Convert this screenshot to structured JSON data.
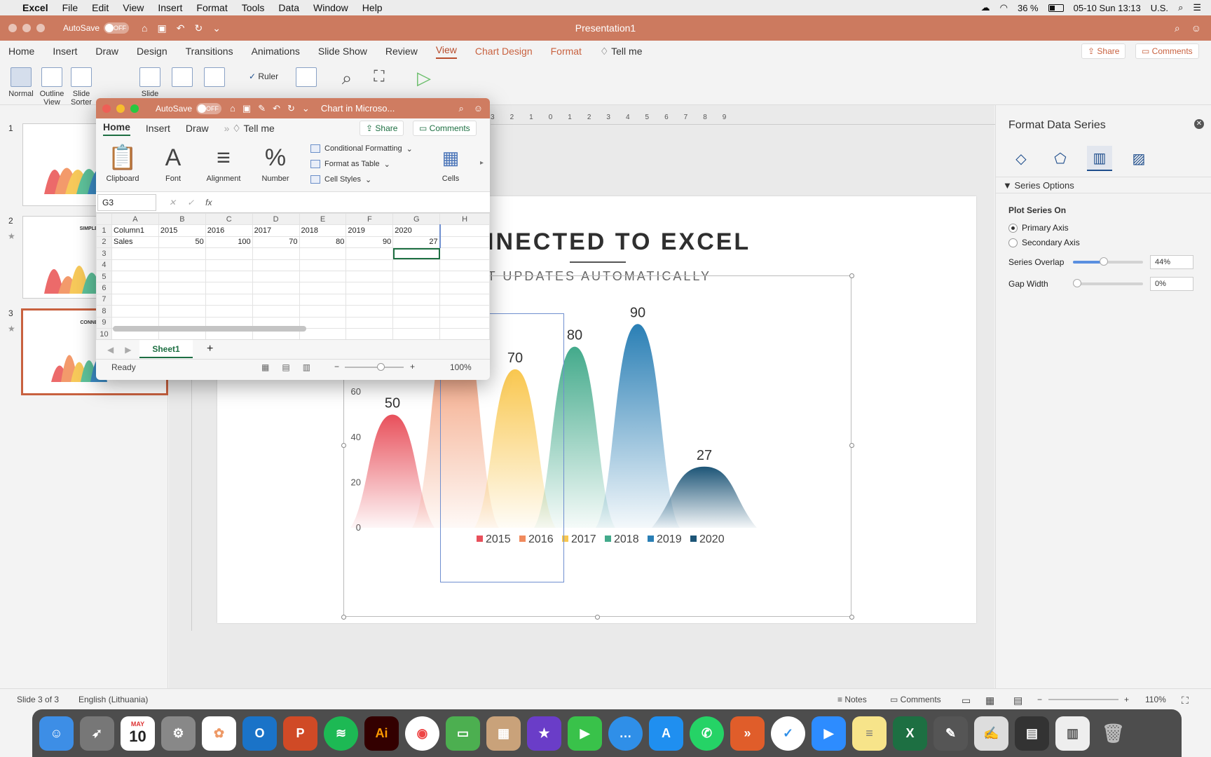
{
  "menubar": {
    "app": "Excel",
    "items": [
      "File",
      "Edit",
      "View",
      "Insert",
      "Format",
      "Tools",
      "Data",
      "Window",
      "Help"
    ],
    "battery": "36 %",
    "datetime": "05-10 Sun  13:13",
    "input_source": "U.S."
  },
  "ppt": {
    "autosave_label": "AutoSave",
    "autosave_state": "OFF",
    "doc_title": "Presentation1",
    "tabs": [
      "Home",
      "Insert",
      "Draw",
      "Design",
      "Transitions",
      "Animations",
      "Slide Show",
      "Review",
      "View",
      "Chart Design",
      "Format"
    ],
    "active_tab": "View",
    "tell_me": "Tell me",
    "share": "Share",
    "comments": "Comments",
    "ribbon": {
      "normal": "Normal",
      "outline": "Outline\nView",
      "sorter": "Slide\nSorter",
      "notes": "Notes",
      "ruler": "Ruler",
      "slide_master": "Slide",
      "handout": "Handout",
      "notes_master": "Notes",
      "zoom": "Zoom",
      "fit": "Fit to",
      "macros": "Macros",
      "notes2": "Notes"
    }
  },
  "thumbnails": [
    {
      "num": "1",
      "title": ""
    },
    {
      "num": "2",
      "title": "SIMPLE COL",
      "sub": "MANUALLY E"
    },
    {
      "num": "3",
      "title": "CONNECTEI",
      "sub": "CHART UPDATES"
    }
  ],
  "slide": {
    "title": "NNECTED TO EXCEL",
    "subtitle": "RT UPDATES AUTOMATICALLY"
  },
  "chart_data": {
    "type": "area",
    "categories": [
      "2015",
      "2016",
      "2017",
      "2018",
      "2019",
      "2020"
    ],
    "values": [
      50,
      100,
      70,
      80,
      90,
      27
    ],
    "series_colors": [
      "#e8505b",
      "#f08a5d",
      "#f9c74f",
      "#43aa8b",
      "#2a7fb5",
      "#1d5577"
    ],
    "data_labels": [
      "50",
      "100",
      "70",
      "80",
      "90",
      "27"
    ],
    "ylim": [
      0,
      100
    ],
    "y_ticks": [
      "0",
      "20",
      "40",
      "60"
    ],
    "legend": [
      "2015",
      "2016",
      "2017",
      "2018",
      "2019",
      "2020"
    ],
    "legend_position": "bottom"
  },
  "excel": {
    "autosave_label": "AutoSave",
    "autosave_state": "OFF",
    "window_title": "Chart in Microso...",
    "tabs": [
      "Home",
      "Insert",
      "Draw"
    ],
    "tell_me": "Tell me",
    "share": "Share",
    "comments": "Comments",
    "groups": {
      "clipboard": "Clipboard",
      "font": "Font",
      "alignment": "Alignment",
      "number": "Number",
      "conditional": "Conditional Formatting",
      "format_table": "Format as Table",
      "cell_styles": "Cell Styles",
      "cells": "Cells"
    },
    "name_box": "G3",
    "fx": "fx",
    "columns": [
      "A",
      "B",
      "C",
      "D",
      "E",
      "F",
      "G",
      "H"
    ],
    "rows": [
      [
        "1",
        "Column1",
        "2015",
        "2016",
        "2017",
        "2018",
        "2019",
        "2020",
        ""
      ],
      [
        "2",
        "Sales",
        "50",
        "100",
        "70",
        "80",
        "90",
        "27",
        ""
      ],
      [
        "3",
        "",
        "",
        "",
        "",
        "",
        "",
        "",
        ""
      ],
      [
        "4",
        "",
        "",
        "",
        "",
        "",
        "",
        "",
        ""
      ],
      [
        "5",
        "",
        "",
        "",
        "",
        "",
        "",
        "",
        ""
      ],
      [
        "6",
        "",
        "",
        "",
        "",
        "",
        "",
        "",
        ""
      ],
      [
        "7",
        "",
        "",
        "",
        "",
        "",
        "",
        "",
        ""
      ],
      [
        "8",
        "",
        "",
        "",
        "",
        "",
        "",
        "",
        ""
      ],
      [
        "9",
        "",
        "",
        "",
        "",
        "",
        "",
        "",
        ""
      ],
      [
        "10",
        "",
        "",
        "",
        "",
        "",
        "",
        "",
        ""
      ]
    ],
    "sheet_tab": "Sheet1",
    "status": "Ready",
    "zoom": "100%"
  },
  "pane": {
    "title": "Format Data Series",
    "section": "Series Options",
    "plot_on": "Plot Series On",
    "primary": "Primary Axis",
    "secondary": "Secondary Axis",
    "overlap_label": "Series Overlap",
    "overlap_value": "44%",
    "overlap_fraction": 0.44,
    "gap_label": "Gap Width",
    "gap_value": "0%",
    "gap_fraction": 0
  },
  "status": {
    "slide": "Slide 3 of 3",
    "language": "English (Lithuania)",
    "notes": "Notes",
    "comments": "Comments",
    "zoom": "110%"
  },
  "dock": {
    "calendar_month": "MAY",
    "calendar_day": "10"
  }
}
